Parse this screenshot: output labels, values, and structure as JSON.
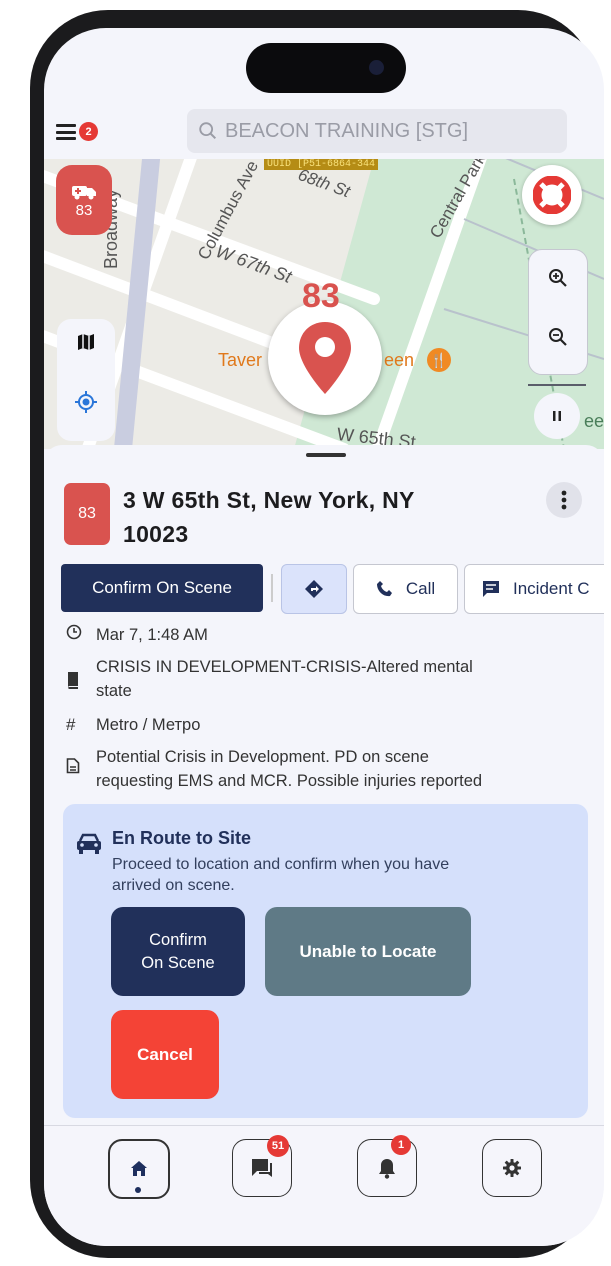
{
  "header": {
    "menu_badge": "2",
    "search_placeholder": "BEACON TRAINING [STG]"
  },
  "map": {
    "unit_fab_label": "83",
    "marker_label": "83",
    "uuid_text": "UUID [P51-6864-344",
    "streets": [
      "Broadway",
      "Columbus Ave",
      "W 67th St",
      "W 65th St",
      "Central Park",
      "68th St"
    ],
    "poi_text": "Tavern on the Green",
    "poi_left": "Taver",
    "poi_right": "een",
    "edge_label": "ee"
  },
  "incident": {
    "unit_number": "83",
    "address_line1": "3 W 65th St, New York, NY",
    "address_line2": "10023",
    "actions": {
      "confirm_label": "Confirm On Scene",
      "call_label": "Call",
      "incident_label": "Incident C"
    },
    "time": "Mar 7, 1:48 AM",
    "type_line1": "CRISIS IN DEVELOPMENT-CRISIS-Altered mental",
    "type_line2": "state",
    "area": "Metro / Метро",
    "notes_line1": "Potential Crisis in Development. PD on scene",
    "notes_line2": "requesting EMS and MCR. Possible injuries reported"
  },
  "task": {
    "title": "En Route to Site",
    "desc_line1": "Proceed to location and confirm when you have",
    "desc_line2": "arrived on scene.",
    "confirm_line1": "Confirm",
    "confirm_line2": "On Scene",
    "unable_label": "Unable to Locate",
    "cancel_label": "Cancel"
  },
  "bottom_nav": {
    "messages_badge": "51",
    "alerts_badge": "1"
  },
  "colors": {
    "navy": "#21305a",
    "slate": "#5f7a86",
    "red": "#f44336",
    "unit_red": "#d9534f",
    "panel": "#d5e0fb"
  }
}
